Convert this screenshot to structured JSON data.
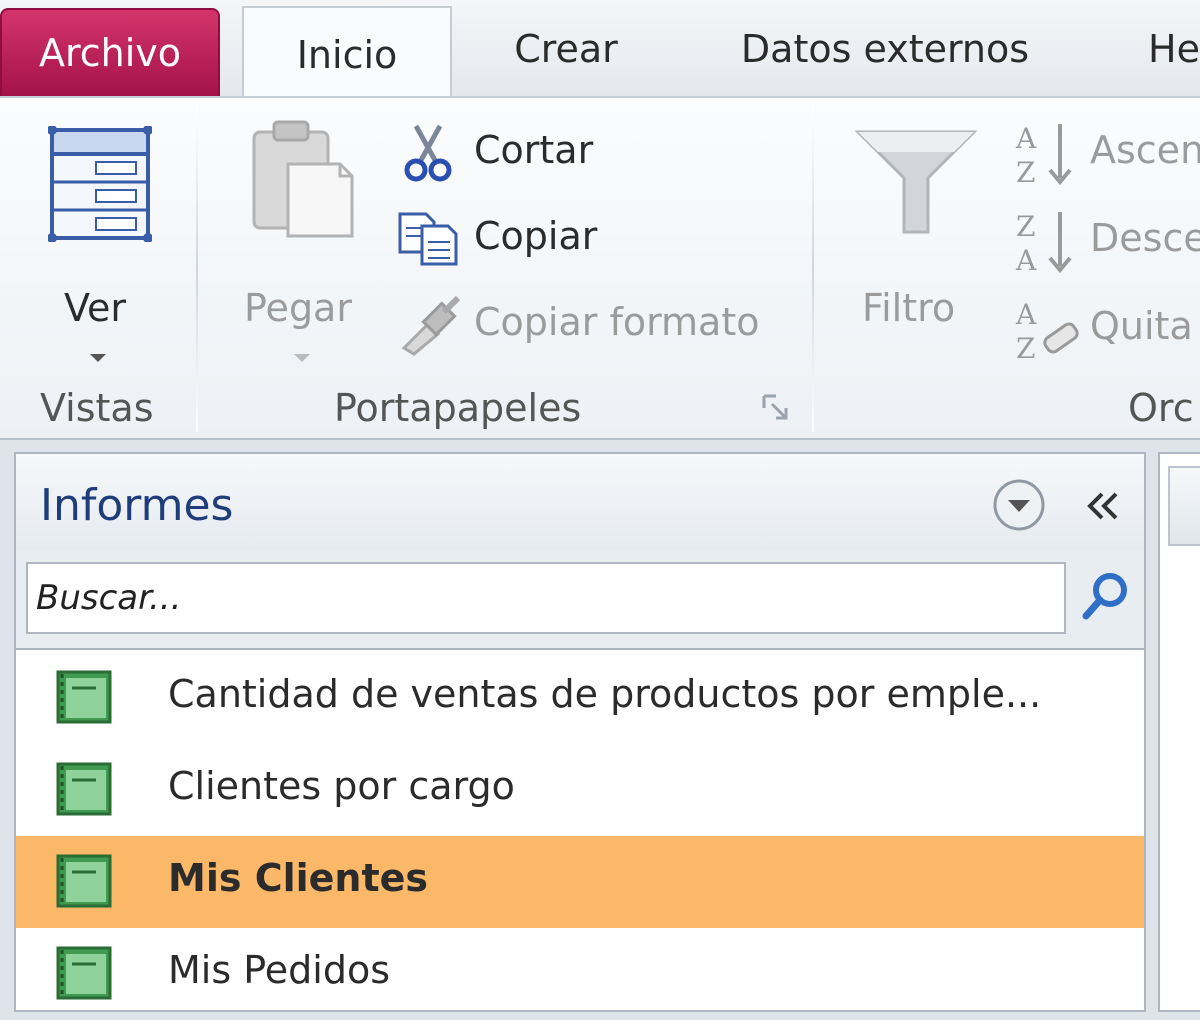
{
  "tabs": {
    "file": "Archivo",
    "home": "Inicio",
    "create": "Crear",
    "external": "Datos externos",
    "next_partial": "He"
  },
  "ribbon": {
    "views": {
      "ver_label": "Ver",
      "group_label": "Vistas"
    },
    "clipboard": {
      "paste_label": "Pegar",
      "cut_label": "Cortar",
      "copy_label": "Copiar",
      "format_painter_label": "Copiar formato",
      "group_label": "Portapapeles"
    },
    "sort": {
      "filter_label": "Filtro",
      "ascending_partial": "Ascen",
      "descending_partial": "Desce",
      "remove_partial": "Quita",
      "group_label_partial": "Orc"
    }
  },
  "nav": {
    "title": "Informes",
    "search_placeholder": "Buscar...",
    "items": [
      {
        "label": "Cantidad de ventas de productos por emple..."
      },
      {
        "label": "Clientes por cargo"
      },
      {
        "label": "Mis Clientes"
      },
      {
        "label": "Mis Pedidos"
      }
    ]
  },
  "colors": {
    "file_tab": "#b81e56",
    "selected_row": "#fab868",
    "nav_title": "#1e3d7a"
  }
}
